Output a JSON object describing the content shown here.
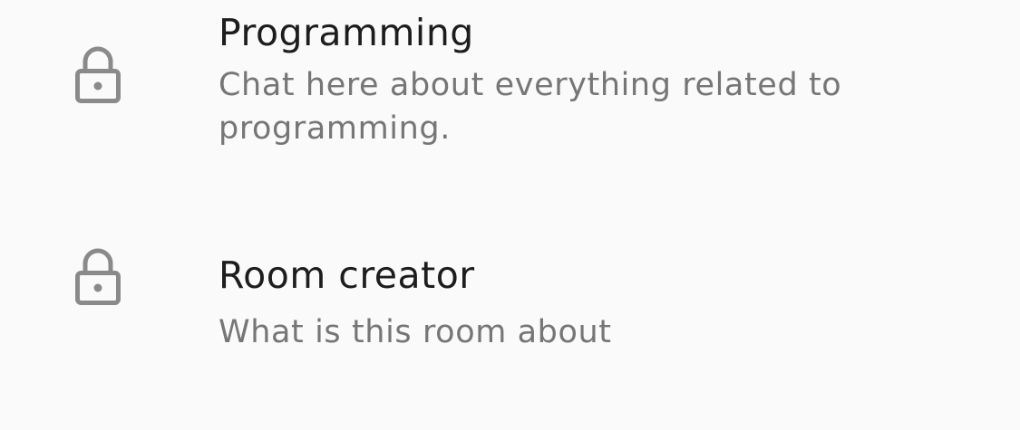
{
  "rooms": [
    {
      "icon": "lock-icon",
      "title": "Programming",
      "description": "Chat here about everything related to programming."
    },
    {
      "icon": "lock-icon",
      "title": "Room creator",
      "description": "What is this room about"
    }
  ]
}
